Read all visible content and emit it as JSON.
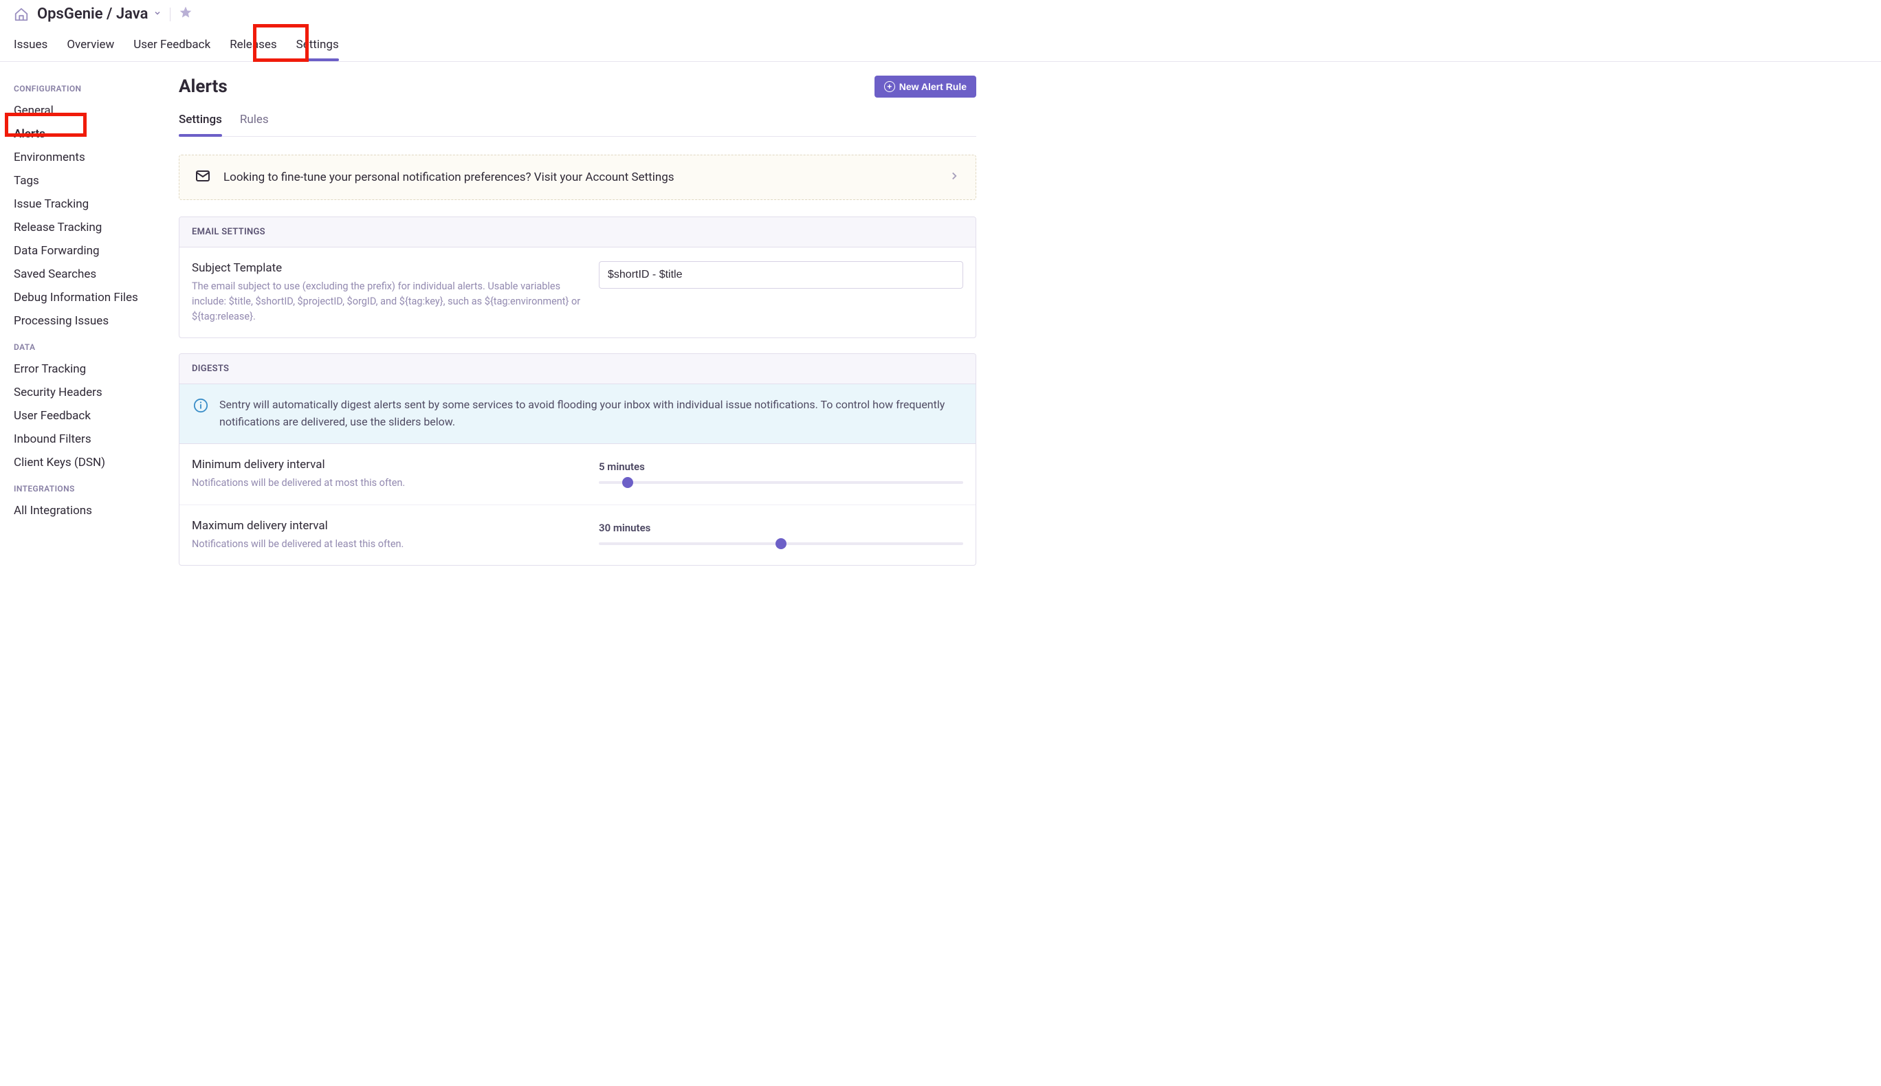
{
  "header": {
    "breadcrumb": "OpsGenie / Java",
    "tabs": [
      {
        "label": "Issues"
      },
      {
        "label": "Overview"
      },
      {
        "label": "User Feedback"
      },
      {
        "label": "Releases"
      },
      {
        "label": "Settings",
        "active": true
      }
    ]
  },
  "sidebar": {
    "sections": [
      {
        "title": "CONFIGURATION",
        "items": [
          {
            "label": "General"
          },
          {
            "label": "Alerts",
            "active": true
          },
          {
            "label": "Environments"
          },
          {
            "label": "Tags"
          },
          {
            "label": "Issue Tracking"
          },
          {
            "label": "Release Tracking"
          },
          {
            "label": "Data Forwarding"
          },
          {
            "label": "Saved Searches"
          },
          {
            "label": "Debug Information Files"
          },
          {
            "label": "Processing Issues"
          }
        ]
      },
      {
        "title": "DATA",
        "items": [
          {
            "label": "Error Tracking"
          },
          {
            "label": "Security Headers"
          },
          {
            "label": "User Feedback"
          },
          {
            "label": "Inbound Filters"
          },
          {
            "label": "Client Keys (DSN)"
          }
        ]
      },
      {
        "title": "INTEGRATIONS",
        "items": [
          {
            "label": "All Integrations"
          }
        ]
      }
    ]
  },
  "content": {
    "title": "Alerts",
    "new_rule_button": "New Alert Rule",
    "sub_tabs": [
      {
        "label": "Settings",
        "active": true
      },
      {
        "label": "Rules"
      }
    ],
    "notice": "Looking to fine-tune your personal notification preferences? Visit your Account Settings",
    "email_settings": {
      "header": "EMAIL SETTINGS",
      "subject_label": "Subject Template",
      "subject_desc": "The email subject to use (excluding the prefix) for individual alerts. Usable variables include: $title, $shortID, $projectID, $orgID, and ${tag:key}, such as ${tag:environment} or ${tag:release}.",
      "subject_value": "$shortID - $title"
    },
    "digests": {
      "header": "DIGESTS",
      "info": "Sentry will automatically digest alerts sent by some services to avoid flooding your inbox with individual issue notifications. To control how frequently notifications are delivered, use the sliders below.",
      "min_label": "Minimum delivery interval",
      "min_desc": "Notifications will be delivered at most this often.",
      "min_value": "5 minutes",
      "min_percent": 8,
      "max_label": "Maximum delivery interval",
      "max_desc": "Notifications will be delivered at least this often.",
      "max_value": "30 minutes",
      "max_percent": 50
    }
  }
}
